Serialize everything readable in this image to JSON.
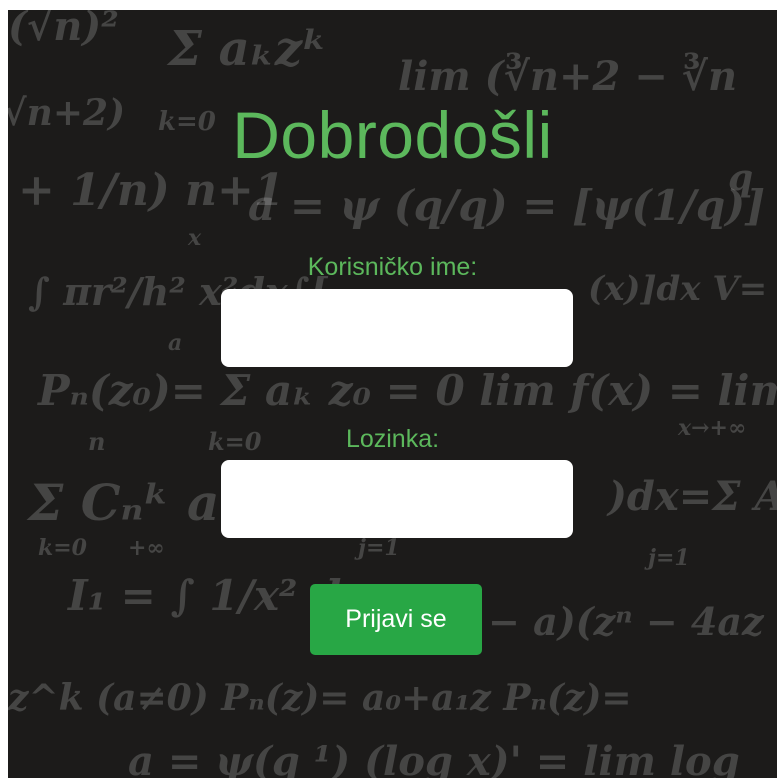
{
  "login": {
    "title": "Dobrodošli",
    "username_label": "Korisničko ime:",
    "username_value": "",
    "password_label": "Lozinka:",
    "password_value": "",
    "submit_label": "Prijavi se"
  },
  "colors": {
    "accent": "#5cb85c",
    "button": "#28a745",
    "background": "#1c1b1a"
  }
}
